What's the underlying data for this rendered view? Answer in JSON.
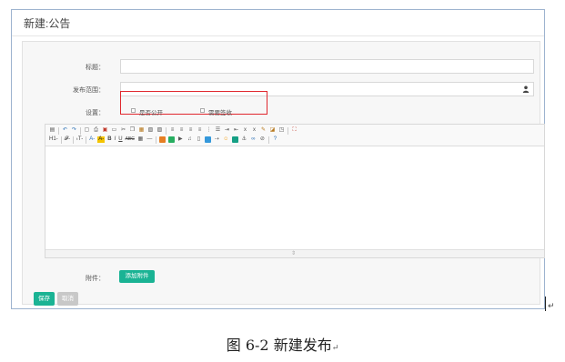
{
  "dialog": {
    "title": "新建:公告"
  },
  "form": {
    "title_label": "标题：",
    "title_value": "",
    "scope_label": "发布范围：",
    "scope_value": "",
    "settings_label": "设置：",
    "option_public": "是否公开",
    "option_public_checked": false,
    "option_receipt": "需要签收",
    "option_receipt_checked": false,
    "attachment_label": "附件：",
    "add_attachment_button": "添加附件"
  },
  "editor": {
    "toolbar_row2_texts": [
      "H1-",
      "𝓕-",
      "ₜT-",
      "A-",
      "A-",
      "B",
      "I",
      "U",
      "ABC"
    ],
    "content": ""
  },
  "actions": {
    "save_button": "保存",
    "cancel_button": "取消"
  },
  "colors": {
    "primary": "#1ab394",
    "disabled": "#c8c8c8",
    "highlight": "#e0282e"
  },
  "caption": {
    "text": "图 6-2  新建发布",
    "mark": "↵"
  }
}
